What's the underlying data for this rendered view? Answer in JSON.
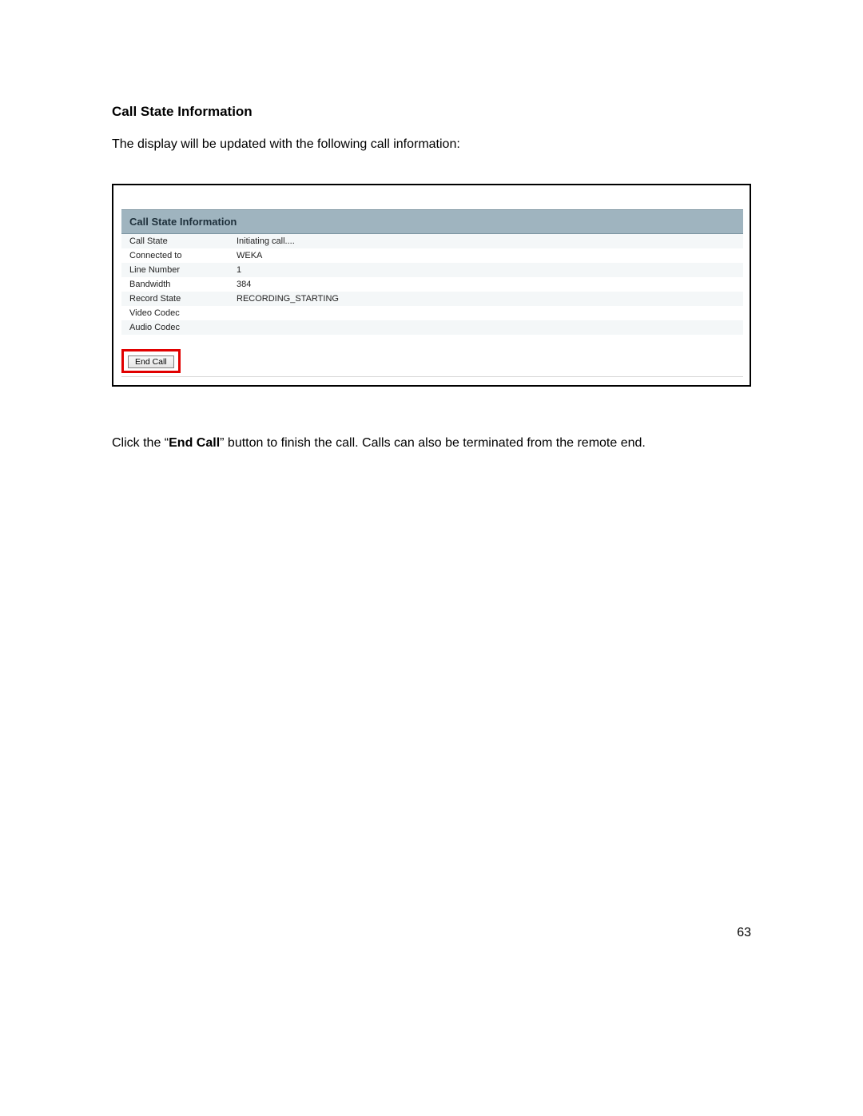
{
  "heading": "Call State Information",
  "intro": "The display will be updated with the following call information:",
  "panel_title": "Call State Information",
  "rows": [
    {
      "label": "Call State",
      "value": "Initiating call...."
    },
    {
      "label": "Connected to",
      "value": "WEKA"
    },
    {
      "label": "Line Number",
      "value": "1"
    },
    {
      "label": "Bandwidth",
      "value": "384"
    },
    {
      "label": "Record State",
      "value": "RECORDING_STARTING"
    },
    {
      "label": "Video Codec",
      "value": ""
    },
    {
      "label": "Audio Codec",
      "value": ""
    }
  ],
  "end_call_label": "End Call",
  "closing_pre": "Click the “",
  "closing_bold": "End Call",
  "closing_post": "” button to finish the call. Calls can also be terminated from the remote end.",
  "page_number": "63"
}
